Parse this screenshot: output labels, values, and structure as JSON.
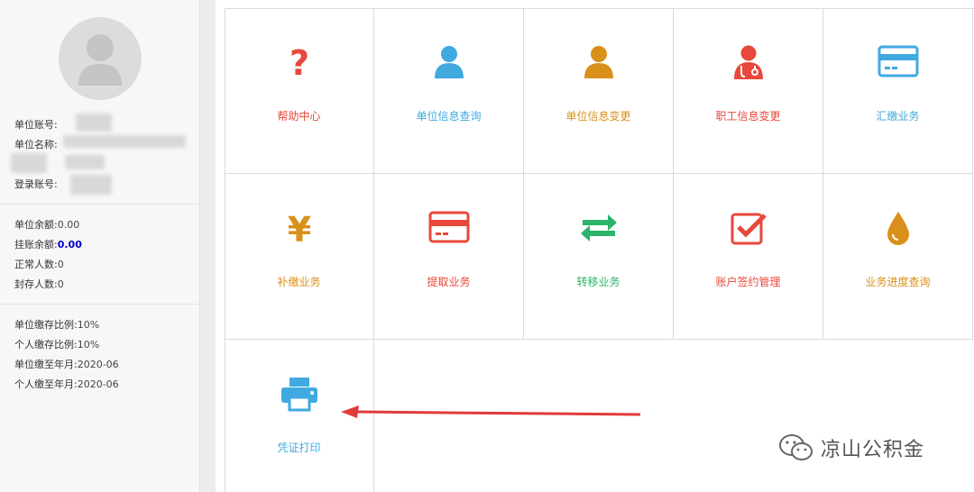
{
  "sidebar": {
    "account_no_label": "单位账号:",
    "unit_name_label": "单位名称:",
    "login_label": "登录账号:",
    "balance_label": "单位余额:",
    "balance_value": "0.00",
    "pending_label": "挂账余额:",
    "pending_value": "0.00",
    "normal_label": "正常人数:",
    "normal_value": "0",
    "sealed_label": "封存人数:",
    "sealed_value": "0",
    "unit_ratio_label": "单位缴存比例:",
    "unit_ratio_value": "10%",
    "personal_ratio_label": "个人缴存比例:",
    "personal_ratio_value": "10%",
    "unit_paid_to_label": "单位缴至年月:",
    "unit_paid_to_value": "2020-06",
    "personal_paid_to_label": "个人缴至年月:",
    "personal_paid_to_value": "2020-06"
  },
  "tiles": [
    {
      "label": "帮助中心",
      "icon": "question-icon",
      "color": "#e8473b"
    },
    {
      "label": "单位信息查询",
      "icon": "user-icon",
      "color": "#3fa9e0"
    },
    {
      "label": "单位信息变更",
      "icon": "user-icon",
      "color": "#d9901a"
    },
    {
      "label": "职工信息变更",
      "icon": "doctor-icon",
      "color": "#e8473b"
    },
    {
      "label": "汇缴业务",
      "icon": "card-icon",
      "color": "#3fa9e0"
    },
    {
      "label": "补缴业务",
      "icon": "yen-icon",
      "color": "#d9901a"
    },
    {
      "label": "提取业务",
      "icon": "card-icon",
      "color": "#e8473b"
    },
    {
      "label": "转移业务",
      "icon": "transfer-icon",
      "color": "#2bb46a"
    },
    {
      "label": "账户签约管理",
      "icon": "checkbox-icon",
      "color": "#e8473b"
    },
    {
      "label": "业务进度查询",
      "icon": "drop-icon",
      "color": "#d9901a"
    },
    {
      "label": "凭证打印",
      "icon": "printer-icon",
      "color": "#3fa9e0"
    }
  ],
  "watermark": {
    "text": "凉山公积金"
  }
}
